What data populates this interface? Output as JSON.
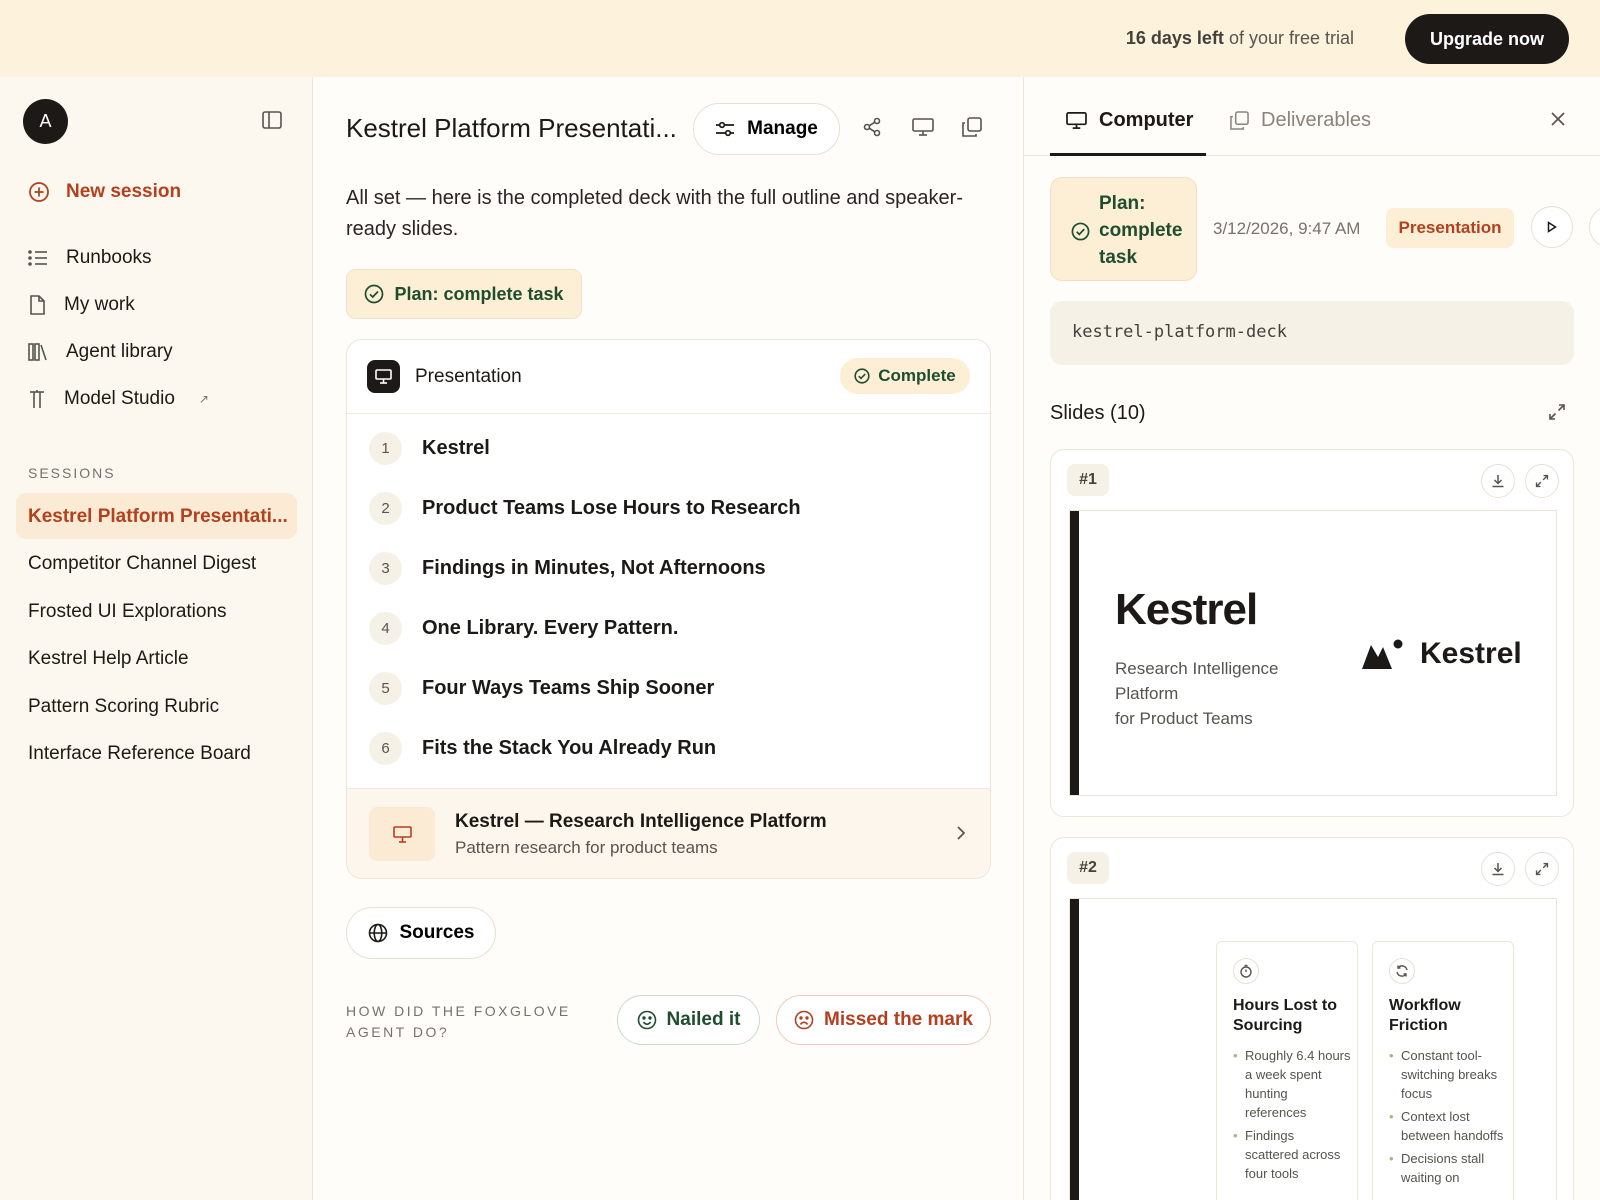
{
  "banner": {
    "trial_strong": "16 days left",
    "trial_rest": " of your free trial",
    "upgrade_label": "Upgrade now"
  },
  "sidebar": {
    "avatar_letter": "A",
    "new_session": "New session",
    "nav": [
      {
        "label": "Runbooks",
        "icon": "list-icon"
      },
      {
        "label": "My work",
        "icon": "file-icon"
      },
      {
        "label": "Agent library",
        "icon": "books-icon"
      },
      {
        "label": "Model Studio",
        "icon": "tool-icon",
        "external": "↗"
      }
    ],
    "sessions_heading": "SESSIONS",
    "sessions": [
      "Kestrel Platform Presentati...",
      "Competitor Channel Digest",
      "Frosted UI Explorations",
      "Kestrel Help Article",
      "Pattern Scoring Rubric",
      "Interface Reference Board"
    ]
  },
  "main": {
    "title": "Kestrel Platform Presentati...",
    "manage_label": "Manage",
    "intro": "All set — here is the completed deck with the full outline and speaker-ready slides.",
    "plan_label": "Plan: complete task",
    "card": {
      "label": "Presentation",
      "status": "Complete",
      "slides": [
        {
          "num": "1",
          "title": "Kestrel"
        },
        {
          "num": "2",
          "title": "Product Teams Lose Hours to Research"
        },
        {
          "num": "3",
          "title": "Findings in Minutes, Not Afternoons"
        },
        {
          "num": "4",
          "title": "One Library. Every Pattern."
        },
        {
          "num": "5",
          "title": "Four Ways Teams Ship Sooner"
        },
        {
          "num": "6",
          "title": "Fits the Stack You Already Run"
        }
      ],
      "deck_title": "Kestrel — Research Intelligence Platform",
      "deck_subtitle": "Pattern research for product teams"
    },
    "sources_label": "Sources",
    "rating_question": "HOW DID THE FOXGLOVE AGENT DO?",
    "nailed_label": "Nailed it",
    "missed_label": "Missed the mark"
  },
  "panel": {
    "tab_computer": "Computer",
    "tab_deliverables": "Deliverables",
    "plan_label": "Plan: complete task",
    "timestamp": "3/12/2026, 9:47 AM",
    "tag": "Presentation",
    "code": "kestrel-platform-deck",
    "slides_heading": "Slides (10)",
    "slide1": {
      "num": "#1",
      "title": "Kestrel",
      "subtitle_lines": [
        "Research Intelligence",
        "Platform",
        "for Product Teams"
      ],
      "logo_text": "Kestrel"
    },
    "slide2": {
      "num": "#2",
      "cards": [
        {
          "title": "Hours Lost to Sourcing",
          "icon": "timer-icon",
          "bullets": [
            "Roughly 6.4 hours a week spent hunting references",
            "Findings scattered across four tools"
          ]
        },
        {
          "title": "Workflow Friction",
          "icon": "refresh-icon",
          "bullets": [
            "Constant tool-switching breaks focus",
            "Context lost between handoffs",
            "Decisions stall waiting on"
          ]
        }
      ]
    }
  }
}
